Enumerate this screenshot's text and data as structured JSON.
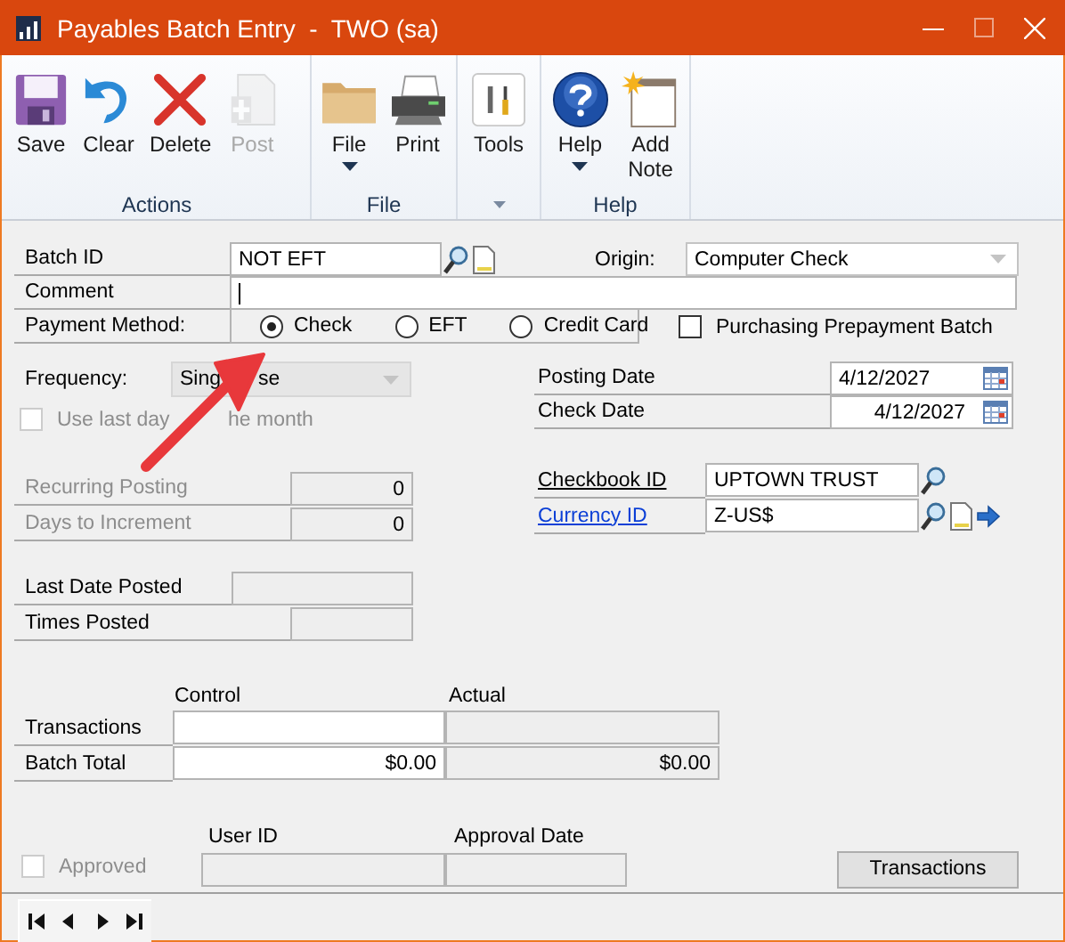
{
  "window": {
    "title": "Payables Batch Entry  -  TWO (sa)"
  },
  "ribbon": {
    "groups": [
      {
        "label": "Actions",
        "buttons": [
          {
            "label": "Save",
            "kind": "save",
            "disabled": false,
            "dropdown": false
          },
          {
            "label": "Clear",
            "kind": "clear",
            "disabled": false,
            "dropdown": false
          },
          {
            "label": "Delete",
            "kind": "delete",
            "disabled": false,
            "dropdown": false
          },
          {
            "label": "Post",
            "kind": "post",
            "disabled": true,
            "dropdown": false
          }
        ]
      },
      {
        "label": "File",
        "buttons": [
          {
            "label": "File",
            "kind": "file",
            "disabled": false,
            "dropdown": true
          },
          {
            "label": "Print",
            "kind": "print",
            "disabled": false,
            "dropdown": false
          }
        ]
      },
      {
        "launcher": true,
        "buttons": [
          {
            "label": "Tools",
            "kind": "tools",
            "disabled": false,
            "dropdown": false
          }
        ]
      },
      {
        "label": "Help",
        "buttons": [
          {
            "label": "Help",
            "kind": "help",
            "disabled": false,
            "dropdown": true
          },
          {
            "label": "Add Note",
            "kind": "note",
            "disabled": false,
            "dropdown": false
          }
        ]
      }
    ]
  },
  "form": {
    "batch_id": {
      "label": "Batch ID",
      "value": "NOT EFT"
    },
    "origin": {
      "label": "Origin:",
      "value": "Computer Check"
    },
    "comment": {
      "label": "Comment"
    },
    "payment_method": {
      "label": "Payment Method:",
      "options": [
        {
          "label": "Check",
          "selected": true
        },
        {
          "label": "EFT",
          "selected": false
        },
        {
          "label": "Credit Card",
          "selected": false
        }
      ]
    },
    "prepayment": {
      "label": "Purchasing Prepayment Batch",
      "checked": false
    },
    "frequency": {
      "label": "Frequency:",
      "value_parts": [
        "Sing",
        "se"
      ]
    },
    "use_last_day": {
      "label_parts": [
        "Use last day",
        "he month"
      ],
      "checked": false,
      "disabled": true
    },
    "dates": [
      {
        "label": "Posting Date",
        "value": "4/12/2027"
      },
      {
        "label": "Check Date",
        "value": "4/12/2027"
      }
    ],
    "recurring": [
      {
        "label": "Recurring Posting",
        "value": "0",
        "disabled": true
      },
      {
        "label": "Days to Increment",
        "value": "0",
        "disabled": true
      }
    ],
    "posted": [
      {
        "label": "Last Date Posted"
      },
      {
        "label": "Times Posted"
      }
    ],
    "accounts": [
      {
        "label": "Checkbook ID",
        "value": "UPTOWN TRUST",
        "link": false,
        "extra": false
      },
      {
        "label": "Currency ID",
        "value": "Z-US$",
        "link": true,
        "extra": true
      }
    ],
    "totals": {
      "columns": [
        "Control",
        "Actual"
      ],
      "rows": [
        {
          "label": "Transactions"
        },
        {
          "label": "Batch Total",
          "control": "$0.00",
          "actual": "$0.00"
        }
      ]
    },
    "approval": {
      "label": "Approved",
      "checked": false,
      "disabled": true,
      "columns": [
        "User ID",
        "Approval Date"
      ]
    },
    "buttons": [
      {
        "label": "Transactions"
      }
    ]
  }
}
